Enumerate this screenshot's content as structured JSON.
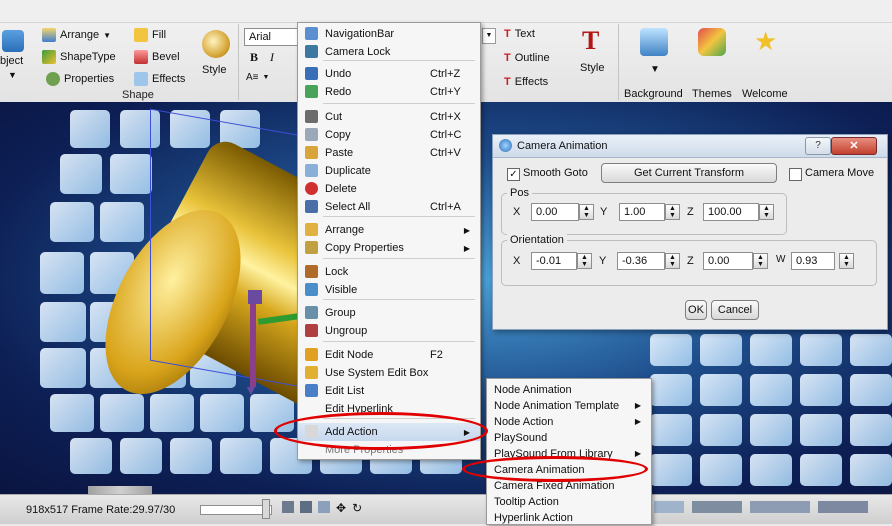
{
  "ribbon": {
    "object_label": "bject",
    "arrange_label": "Arrange",
    "fill_label": "Fill",
    "shapetype_label": "ShapeType",
    "bevel_label": "Bevel",
    "style_label": "Style",
    "properties_label": "Properties",
    "effects_label": "Effects",
    "shape_group_label": "Shape",
    "font_value": "Arial",
    "bold_label": "B",
    "italic_label": "I",
    "text_label": "Text",
    "outline_label": "Outline",
    "text_effects_label": "Effects",
    "text_style_label": "Style",
    "background_label": "Background",
    "themes_label": "Themes",
    "welcome_label": "Welcome"
  },
  "context_menu": {
    "items": [
      {
        "label": "NavigationBar",
        "icon": "navigation-bar-icon"
      },
      {
        "label": "Camera Lock",
        "icon": "camera-lock-icon"
      },
      {
        "label": "Undo",
        "shortcut": "Ctrl+Z",
        "icon": "undo-icon"
      },
      {
        "label": "Redo",
        "shortcut": "Ctrl+Y",
        "icon": "redo-icon"
      },
      {
        "label": "Cut",
        "shortcut": "Ctrl+X",
        "icon": "cut-icon"
      },
      {
        "label": "Copy",
        "shortcut": "Ctrl+C",
        "icon": "copy-icon"
      },
      {
        "label": "Paste",
        "shortcut": "Ctrl+V",
        "icon": "paste-icon"
      },
      {
        "label": "Duplicate",
        "icon": "duplicate-icon"
      },
      {
        "label": "Delete",
        "icon": "delete-icon"
      },
      {
        "label": "Select All",
        "shortcut": "Ctrl+A",
        "icon": "select-all-icon"
      },
      {
        "label": "Arrange",
        "icon": "arrange-icon"
      },
      {
        "label": "Copy Properties",
        "icon": "copy-properties-icon"
      },
      {
        "label": "Lock",
        "icon": "lock-icon"
      },
      {
        "label": "Visible",
        "icon": "visible-icon"
      },
      {
        "label": "Group",
        "icon": "group-icon"
      },
      {
        "label": "Ungroup",
        "icon": "ungroup-icon"
      },
      {
        "label": "Edit Node",
        "shortcut": "F2",
        "icon": "edit-node-icon"
      },
      {
        "label": "Use System Edit Box",
        "icon": "edit-box-icon"
      },
      {
        "label": "Edit List",
        "icon": "edit-list-icon"
      },
      {
        "label": "Edit Hyperlink"
      },
      {
        "label": "Add Action",
        "icon": "add-action-icon"
      },
      {
        "label": "More Properties"
      }
    ]
  },
  "submenu": {
    "items": [
      {
        "label": "Node Animation"
      },
      {
        "label": "Node Animation Template"
      },
      {
        "label": "Node Action"
      },
      {
        "label": "PlaySound"
      },
      {
        "label": "PlaySound From Library"
      },
      {
        "label": "Camera Animation"
      },
      {
        "label": "Camera Fixed Animation"
      },
      {
        "label": "Tooltip Action"
      },
      {
        "label": "Hyperlink Action"
      }
    ]
  },
  "dialog": {
    "title": "Camera Animation",
    "smooth_goto_label": "Smooth Goto",
    "smooth_goto_checked": true,
    "get_transform_label": "Get Current Transform",
    "camera_move_label": "Camera Move",
    "camera_move_checked": false,
    "pos_label": "Pos",
    "pos": {
      "x_label": "X",
      "x": "0.00",
      "y_label": "Y",
      "y": "1.00",
      "z_label": "Z",
      "z": "100.00"
    },
    "orientation_label": "Orientation",
    "orientation": {
      "x_label": "X",
      "x": "-0.01",
      "y_label": "Y",
      "y": "-0.36",
      "z_label": "Z",
      "z": "0.00",
      "w_label": "W",
      "w": "0.93"
    },
    "ok_label": "OK",
    "cancel_label": "Cancel"
  },
  "statusbar": {
    "info": "918x517 Frame Rate:29.97/30"
  },
  "colors": {
    "highlight_ring": "#e00000",
    "scene_bg": "#1e4e8c"
  }
}
